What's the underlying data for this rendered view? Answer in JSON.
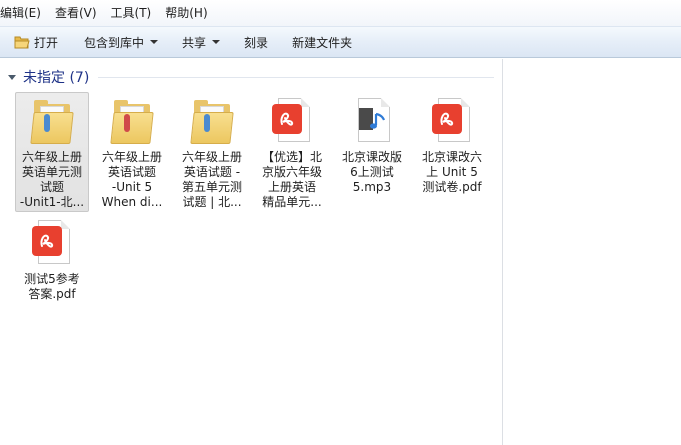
{
  "menu": {
    "items": [
      "编辑(E)",
      "查看(V)",
      "工具(T)",
      "帮助(H)"
    ]
  },
  "toolbar": {
    "open_label": "打开",
    "include_label": "包含到库中",
    "share_label": "共享",
    "burn_label": "刻录",
    "new_folder_label": "新建文件夹"
  },
  "group": {
    "title": "未指定 (7)"
  },
  "files": [
    {
      "type": "folder",
      "icon": "folder-icon",
      "lines": [
        "六年级上册",
        "英语单元测",
        "试题",
        "-Unit1-北..."
      ],
      "selected": true
    },
    {
      "type": "folder",
      "icon": "folder-icon",
      "lines": [
        "六年级上册",
        "英语试题",
        "-Unit 5",
        "When di..."
      ],
      "selected": false
    },
    {
      "type": "folder",
      "icon": "folder-icon",
      "lines": [
        "六年级上册",
        "英语试题 -",
        "第五单元测",
        "试题 | 北..."
      ],
      "selected": false
    },
    {
      "type": "pdf",
      "icon": "pdf-icon",
      "lines": [
        "【优选】北",
        "京版六年级",
        "上册英语",
        "精品单元..."
      ],
      "selected": false
    },
    {
      "type": "mp3",
      "icon": "audio-file-icon",
      "lines": [
        "北京课改版",
        "6上测试",
        "5.mp3"
      ],
      "selected": false
    },
    {
      "type": "pdf",
      "icon": "pdf-icon",
      "lines": [
        "北京课改六",
        "上 Unit 5",
        "测试卷.pdf"
      ],
      "selected": false
    },
    {
      "type": "pdf",
      "icon": "pdf-icon",
      "lines": [
        "测试5参考",
        "答案.pdf"
      ],
      "selected": false
    }
  ]
}
